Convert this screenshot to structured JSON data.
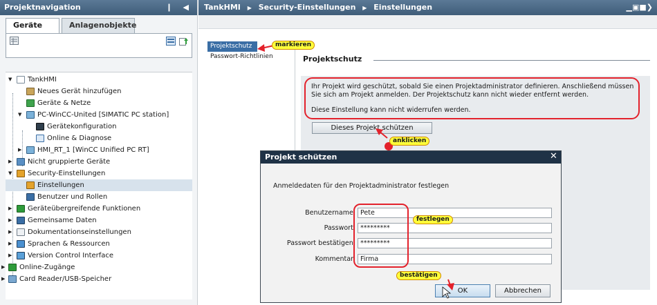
{
  "left_panel": {
    "title": "Projektnavigation",
    "controls": "❙ ◀",
    "tabs": [
      "Geräte",
      "Anlagenobjekte"
    ],
    "tree": [
      {
        "label": "TankHMI",
        "icon": "project-icon"
      },
      {
        "label": "Neues Gerät hinzufügen",
        "icon": "add-device-icon"
      },
      {
        "label": "Geräte & Netze",
        "icon": "network-icon"
      },
      {
        "label": "PC-WinCC-United [SIMATIC PC station]",
        "icon": "pc-station-icon"
      },
      {
        "label": "Gerätekonfiguration",
        "icon": "config-icon"
      },
      {
        "label": "Online & Diagnose",
        "icon": "diagnose-icon"
      },
      {
        "label": "HMI_RT_1 [WinCC Unified PC RT]",
        "icon": "hmi-runtime-icon"
      },
      {
        "label": "Nicht gruppierte Geräte",
        "icon": "ungrouped-devices-icon"
      },
      {
        "label": "Security-Einstellungen",
        "icon": "security-icon"
      },
      {
        "label": "Einstellungen",
        "icon": "settings-icon"
      },
      {
        "label": "Benutzer und Rollen",
        "icon": "users-icon"
      },
      {
        "label": "Geräteübergreifende Funktionen",
        "icon": "cross-device-icon"
      },
      {
        "label": "Gemeinsame Daten",
        "icon": "common-data-icon"
      },
      {
        "label": "Dokumentationseinstellungen",
        "icon": "documentation-icon"
      },
      {
        "label": "Sprachen & Ressourcen",
        "icon": "languages-icon"
      },
      {
        "label": "Version Control Interface",
        "icon": "version-control-icon"
      },
      {
        "label": "Online-Zugänge",
        "icon": "online-access-icon"
      },
      {
        "label": "Card Reader/USB-Speicher",
        "icon": "card-reader-icon"
      }
    ]
  },
  "header": {
    "breadcrumb": [
      "TankHMI",
      "Security-Einstellungen",
      "Einstellungen"
    ],
    "separator": "▶",
    "window_controls": "▁▣■❯"
  },
  "right_nav": {
    "items": [
      "Projektschutz",
      "Passwort-Richtlinien"
    ]
  },
  "main": {
    "section_title": "Projektschutz",
    "info_text": "Ihr Projekt wird geschützt, sobald Sie einen Projektadministrator definieren. Anschließend müssen Sie sich am Projekt anmelden. Der Projektschutz kann nicht wieder entfernt werden.",
    "info_text2": "Diese Einstellung kann nicht widerrufen werden.",
    "protect_button": "Dieses Projekt schützen"
  },
  "dialog": {
    "title": "Projekt schützen",
    "close": "✕",
    "description": "Anmeldedaten für den Projektadministrator festlegen",
    "fields": [
      {
        "label": "Benutzername:",
        "value": "Pete"
      },
      {
        "label": "Passwort:",
        "value": "*********"
      },
      {
        "label": "Passwort bestätigen:",
        "value": "*********"
      },
      {
        "label": "Kommentar:",
        "value": "Firma"
      }
    ],
    "ok": "OK",
    "cancel": "Abbrechen"
  },
  "annotations": {
    "markieren": "markieren",
    "anklicken": "anklicken",
    "festlegen": "festlegen",
    "bestaetigen": "bestätigen"
  },
  "colors": {
    "title_bar": "#3f5d79",
    "dialog_title": "#1f3246",
    "selection": "#3a6ea5",
    "annotation_red": "#e3212b",
    "callout_yellow": "#ffff3a"
  }
}
